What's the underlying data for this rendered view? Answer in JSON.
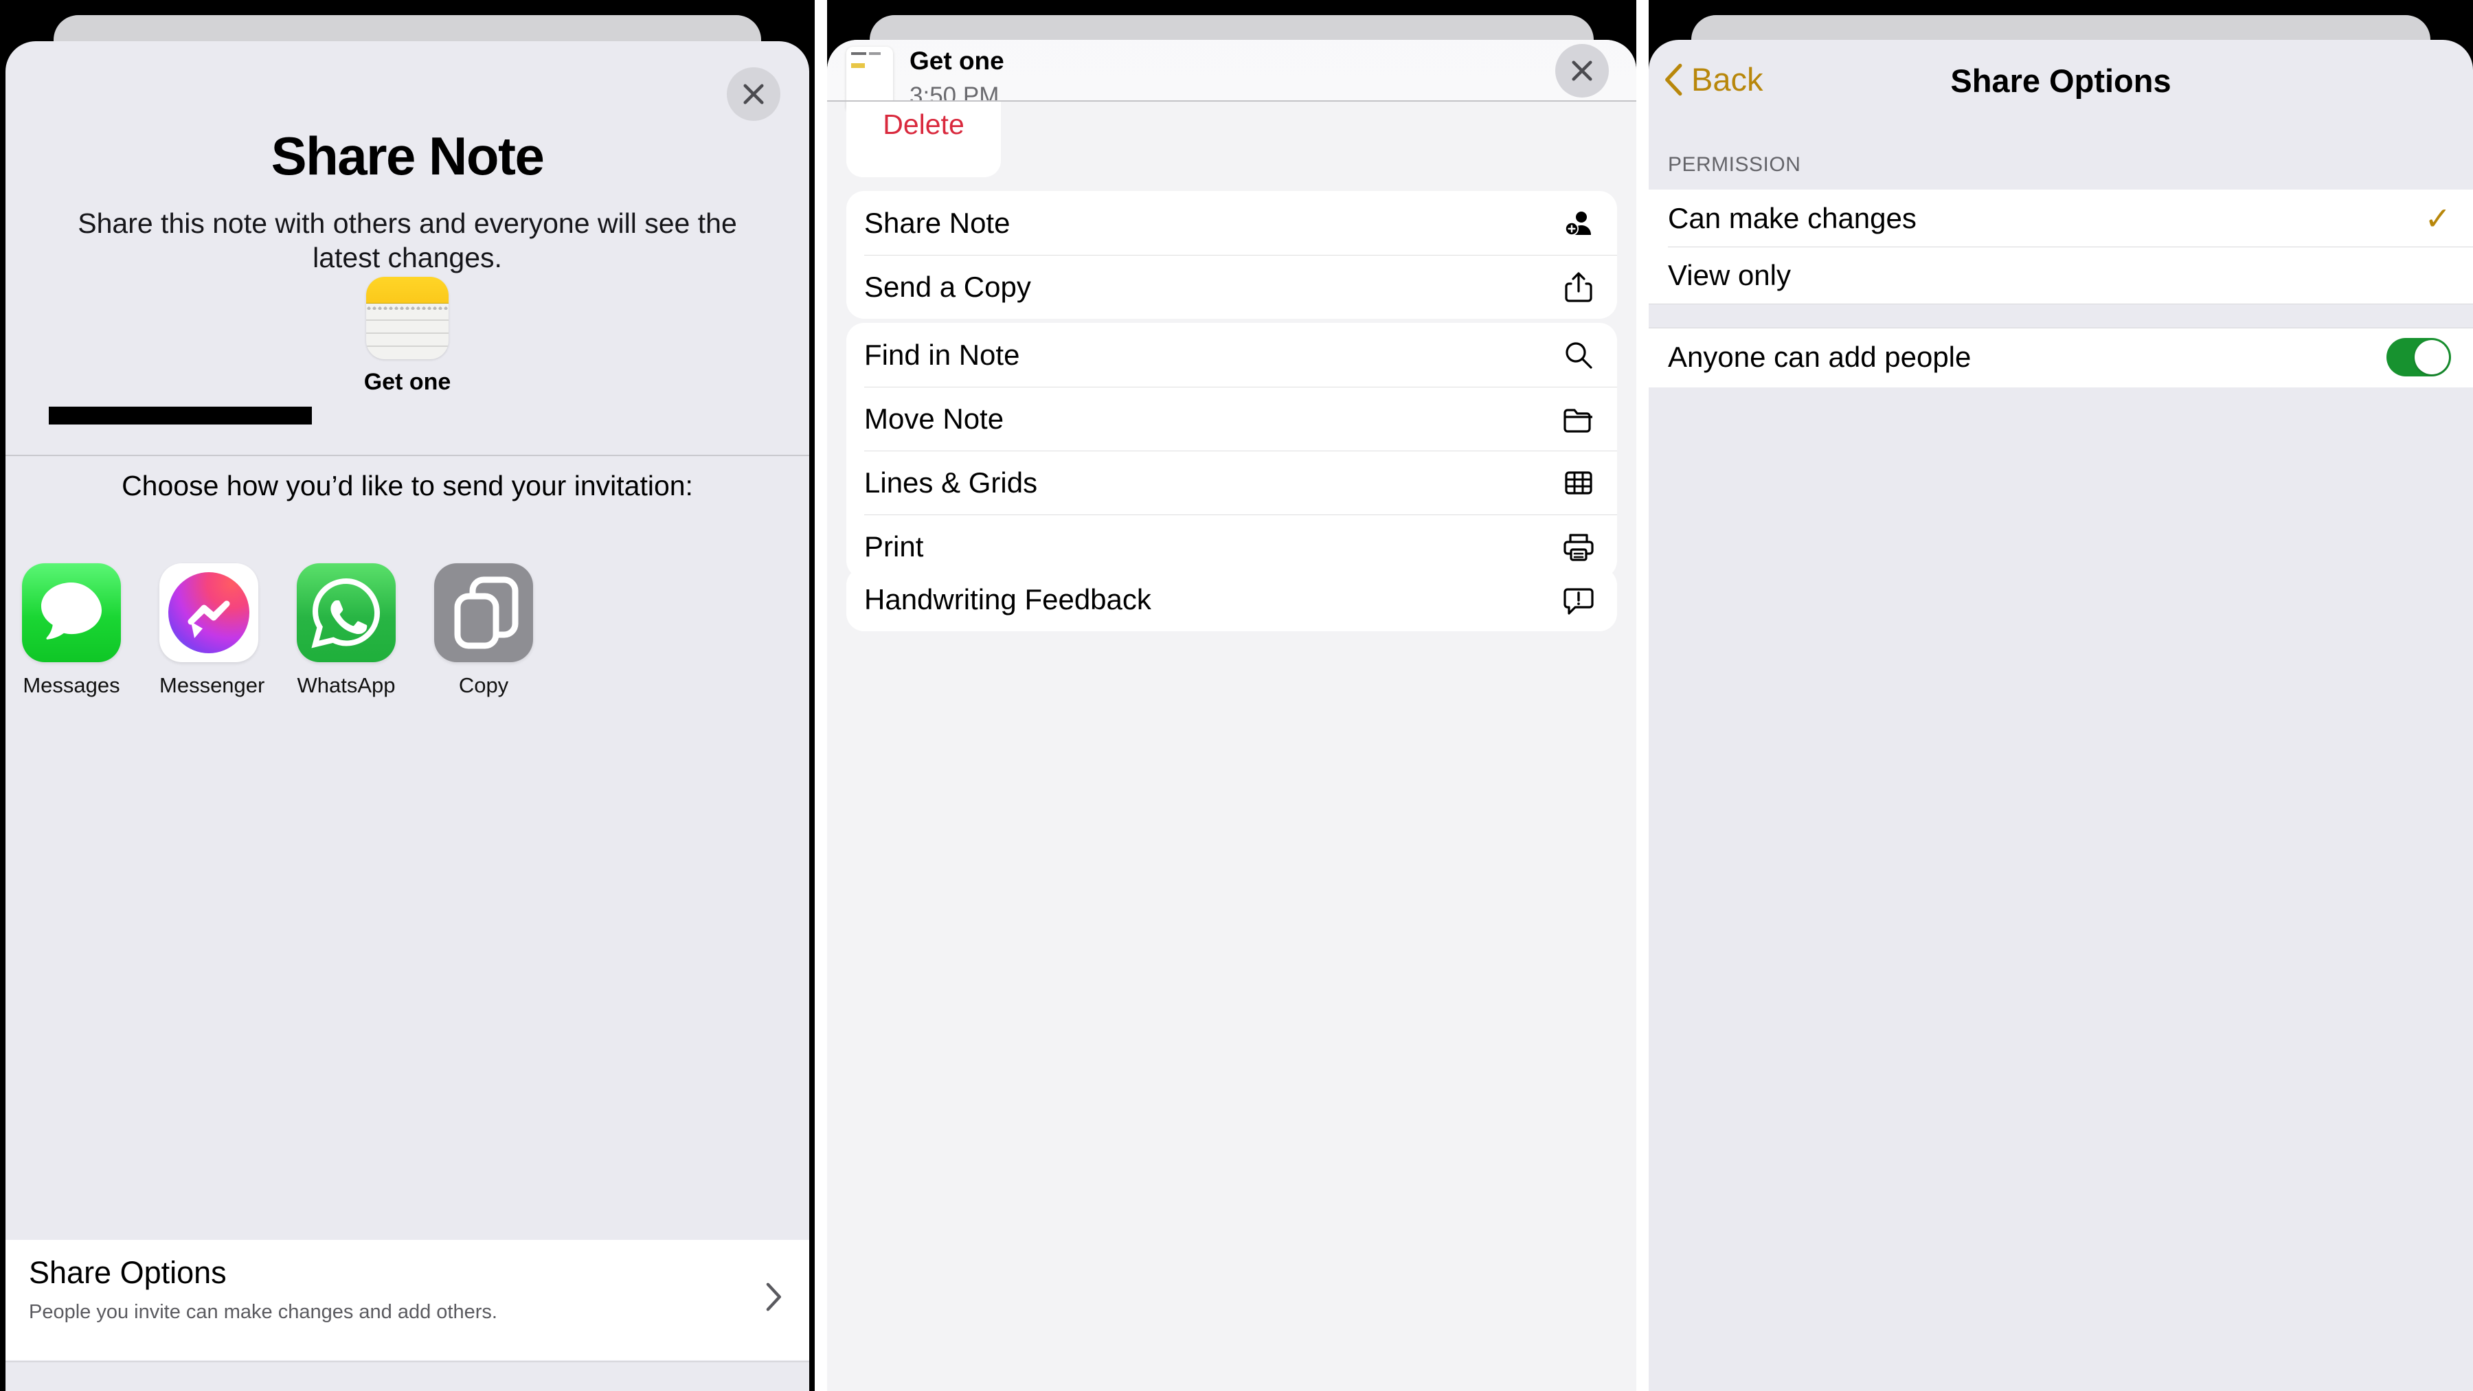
{
  "panel1": {
    "close_icon": "close-icon",
    "title": "Share Note",
    "subtitle": "Share this note with others and everyone will see the latest changes.",
    "note_icon": "notes-app-icon",
    "note_name": "Get one",
    "choose_prompt": "Choose how you’d like to send your invitation:",
    "apps": [
      {
        "label": "Messages",
        "icon": "messages-app-icon"
      },
      {
        "label": "Messenger",
        "icon": "messenger-app-icon"
      },
      {
        "label": "WhatsApp",
        "icon": "whatsapp-app-icon"
      },
      {
        "label": "Copy",
        "icon": "copy-icon"
      }
    ],
    "share_options": {
      "title": "Share Options",
      "subtitle": "People you invite can make changes and add others.",
      "chevron": "chevron-right-icon"
    }
  },
  "panel2": {
    "note_title": "Get one",
    "note_time": "3:50 PM",
    "close_icon": "close-icon",
    "delete_label": "Delete",
    "groups": [
      {
        "items": [
          {
            "label": "Share Note",
            "icon": "person-badge-plus-icon"
          },
          {
            "label": "Send a Copy",
            "icon": "share-up-arrow-icon"
          }
        ]
      },
      {
        "items": [
          {
            "label": "Find in Note",
            "icon": "magnifying-glass-icon"
          },
          {
            "label": "Move Note",
            "icon": "folder-icon"
          },
          {
            "label": "Lines & Grids",
            "icon": "grid-icon"
          },
          {
            "label": "Print",
            "icon": "printer-icon"
          }
        ]
      },
      {
        "items": [
          {
            "label": "Handwriting Feedback",
            "icon": "speech-bubble-exclamation-icon"
          }
        ]
      }
    ]
  },
  "panel3": {
    "back_label": "Back",
    "back_icon": "chevron-left-icon",
    "nav_title": "Share Options",
    "section_header": "PERMISSION",
    "permission_rows": [
      {
        "label": "Can make changes",
        "checked": true,
        "check_glyph": "✓"
      },
      {
        "label": "View only",
        "checked": false,
        "check_glyph": ""
      }
    ],
    "toggle_row": {
      "label": "Anyone can add people",
      "on": true
    }
  },
  "colors": {
    "sheet_bg": "#eaeaf0",
    "card_white": "#ffffff",
    "accent_gold": "#b8870b",
    "destructive_red": "#d9293d",
    "toggle_green": "#17922f",
    "notes_yellow": "#ffd527"
  }
}
